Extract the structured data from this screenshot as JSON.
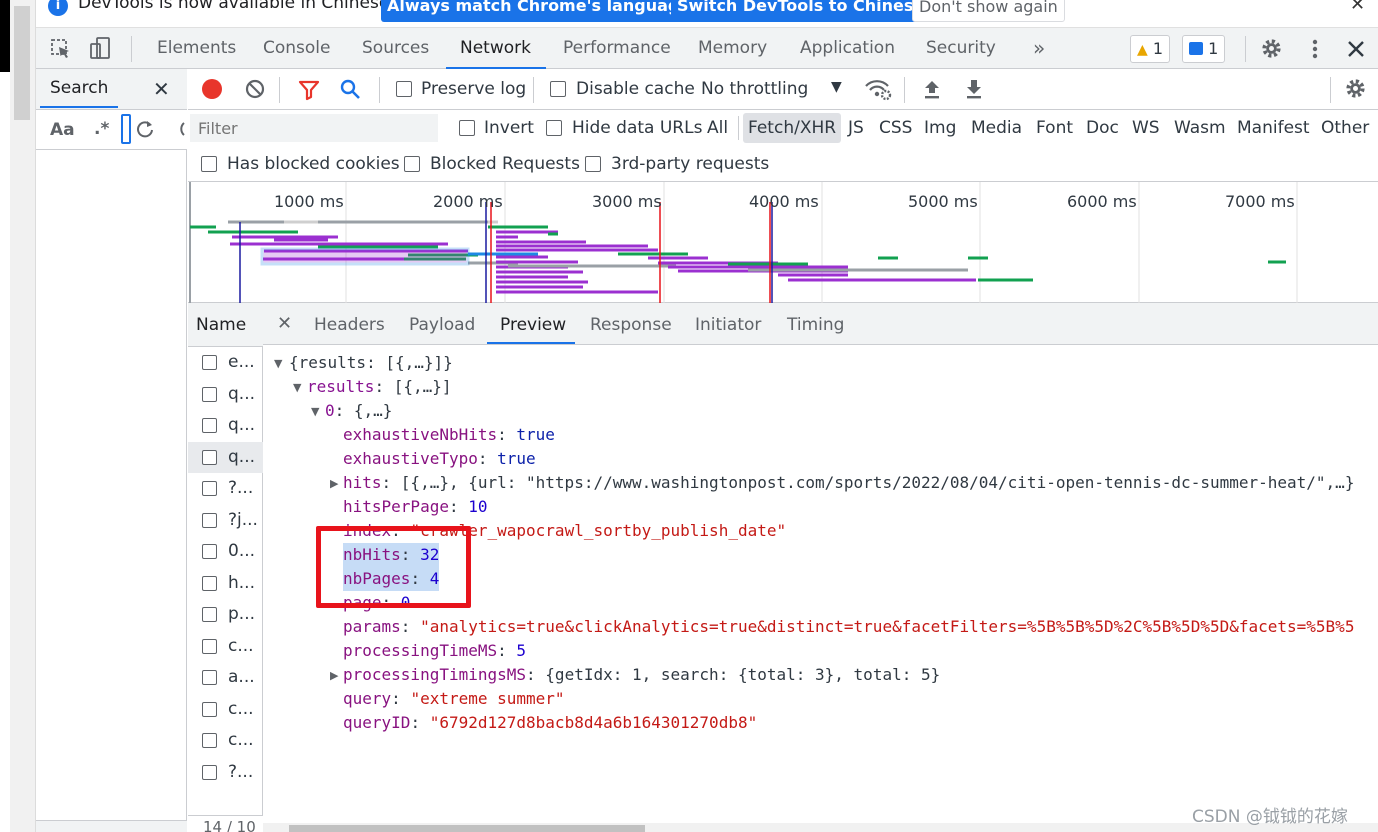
{
  "notice": {
    "text": "DevTools is now available in Chinese!",
    "btn_match": "Always match Chrome's language",
    "btn_switch": "Switch DevTools to Chinese",
    "btn_dont": "Don't show again",
    "close": "✕"
  },
  "main_tabs": [
    "Elements",
    "Console",
    "Sources",
    "Network",
    "Performance",
    "Memory",
    "Application",
    "Security"
  ],
  "more_tabs": "»",
  "badges": {
    "warnings": "1",
    "messages": "1"
  },
  "search": {
    "tab_label": "Search",
    "close": "✕",
    "match_case": "Aa",
    "regex": ".*"
  },
  "toolbar": {
    "preserve_log": "Preserve log",
    "disable_cache": "Disable cache",
    "throttling": "No throttling"
  },
  "filter": {
    "placeholder": "Filter",
    "invert": "Invert",
    "hide_data_urls": "Hide data URLs",
    "types": [
      "All",
      "Fetch/XHR",
      "JS",
      "CSS",
      "Img",
      "Media",
      "Font",
      "Doc",
      "WS",
      "Wasm",
      "Manifest",
      "Other"
    ],
    "has_blocked_cookies": "Has blocked cookies",
    "blocked_requests": "Blocked Requests",
    "third_party": "3rd-party requests"
  },
  "overview": {
    "ticks": [
      "1000 ms",
      "2000 ms",
      "3000 ms",
      "4000 ms",
      "5000 ms",
      "6000 ms",
      "7000 ms"
    ]
  },
  "requests": {
    "header": "Name",
    "names": [
      "e...",
      "q...",
      "q...",
      "q...",
      "?...",
      "?j...",
      "0...",
      "h...",
      "p...",
      "c...",
      "a...",
      "c...",
      "c...",
      "?..."
    ],
    "footer": "14 / 10"
  },
  "detail_tabs": [
    "Headers",
    "Payload",
    "Preview",
    "Response",
    "Initiator",
    "Timing"
  ],
  "preview": {
    "root": "{results: [{,…}]}",
    "results_key": "results",
    "results_val": "[{,…}]",
    "item_key": "0",
    "item_val": "{,…}",
    "fields": {
      "exhaustiveNbHits": "true",
      "exhaustiveTypo": "true",
      "hits": "[{,…}, {url: \"https://www.washingtonpost.com/sports/2022/08/04/citi-open-tennis-dc-summer-heat/\",…}",
      "hitsPerPage": "10",
      "index": "\"crawler_wapocrawl_sortby_publish_date\"",
      "nbHits": "32",
      "nbPages": "4",
      "page": "0",
      "params": "\"analytics=true&clickAnalytics=true&distinct=true&facetFilters=%5B%5B%5D%2C%5B%5D%5D&facets=%5B%5",
      "processingTimeMS": "5",
      "processingTimingsMS": "{getIdx: 1, search: {total: 3}, total: 5}",
      "query": "\"extreme summer\"",
      "queryID": "\"6792d127d8bacb8d4a6b164301270db8\""
    }
  },
  "watermark": "CSDN @钺钺的花嫁",
  "colors": {
    "accent": "#1a73e8",
    "highlight_box": "#e8131b",
    "record": "#e8352b"
  }
}
